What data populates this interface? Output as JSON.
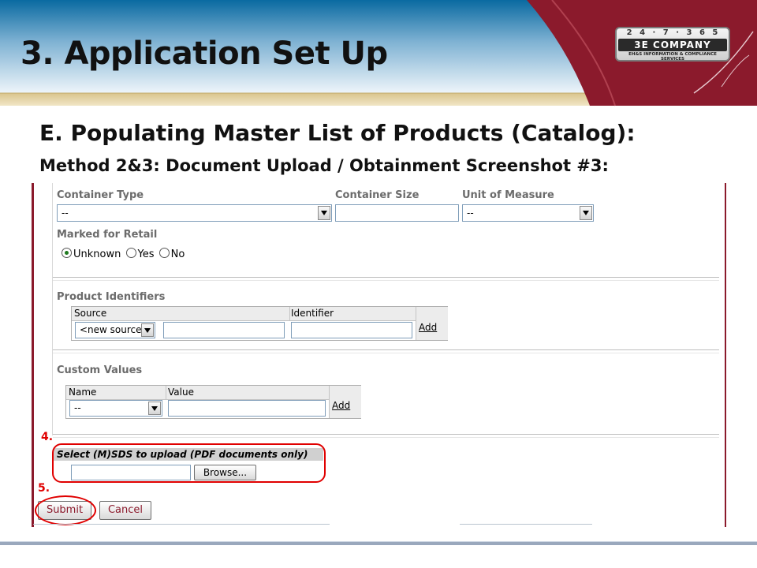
{
  "slide": {
    "title": "3. Application Set Up",
    "section_heading": "E. Populating Master List of Products (Catalog):",
    "sub_heading": "Method 2&3: Document Upload / Obtainment Screenshot #3:",
    "logo": {
      "line1": "2 4 · 7 · 3 6 5",
      "line2": "3E COMPANY",
      "line3": "EH&S INFORMATION & COMPLIANCE SERVICES"
    },
    "colors": {
      "header_blue": "#0a6aa1",
      "header_maroon": "#8b1a2c",
      "tan_band": "#e8d7a8",
      "annotation_red": "#e00000"
    }
  },
  "form": {
    "container_type": {
      "label": "Container Type",
      "value": "--"
    },
    "container_size": {
      "label": "Container Size",
      "value": ""
    },
    "unit_of_measure": {
      "label": "Unit of Measure",
      "value": "--"
    },
    "marked_for_retail": {
      "label": "Marked for Retail",
      "options": [
        "Unknown",
        "Yes",
        "No"
      ],
      "selected": "Unknown"
    },
    "product_identifiers": {
      "label": "Product Identifiers",
      "col_source": "Source",
      "col_identifier": "Identifier",
      "source_value": "<new source>",
      "add_label": "Add"
    },
    "custom_values": {
      "label": "Custom Values",
      "col_name": "Name",
      "col_value": "Value",
      "name_value": "--",
      "add_label": "Add"
    },
    "upload": {
      "label": "Select (M)SDS to upload (PDF documents only)",
      "browse_label": "Browse..."
    },
    "submit_label": "Submit",
    "cancel_label": "Cancel"
  },
  "annotations": {
    "step4": "4.",
    "step5": "5."
  }
}
